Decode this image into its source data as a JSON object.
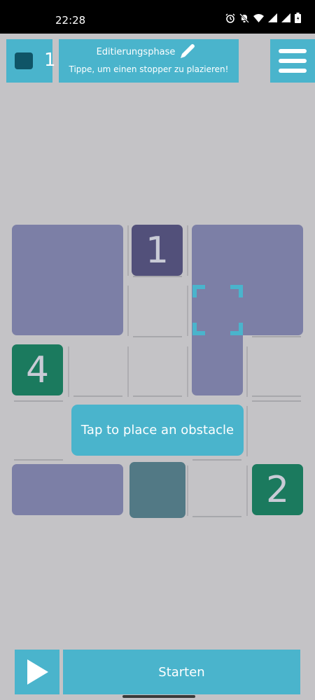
{
  "status_bar": {
    "time": "22:28",
    "icons": [
      "alarm-icon",
      "bell-off-icon",
      "wifi-icon",
      "signal-icon",
      "signal-icon",
      "battery-icon"
    ]
  },
  "header": {
    "counter_value": "1",
    "phase_title": "Editierungsphase",
    "phase_hint": "Tippe, um einen stopper zu plazieren!",
    "menu_icon": "hamburger-menu-icon",
    "pencil_icon": "pencil-icon"
  },
  "board": {
    "tiles": [
      {
        "label": "1",
        "kind": "numbered"
      },
      {
        "label": "4",
        "kind": "numbered"
      },
      {
        "label": "2",
        "kind": "numbered"
      }
    ],
    "selection_icon": "selection-brackets-icon",
    "colors": {
      "background": "#c4c3c6",
      "lavender_block": "#7c7fa6",
      "purple_tile": "#52507a",
      "green_tile": "#1b7a5e",
      "teal_obstacle": "#527985",
      "accent": "#4ab4cc"
    }
  },
  "tooltip": {
    "text": "Tap to place an obstacle"
  },
  "footer": {
    "play_icon": "play-icon",
    "start_label": "Starten"
  }
}
